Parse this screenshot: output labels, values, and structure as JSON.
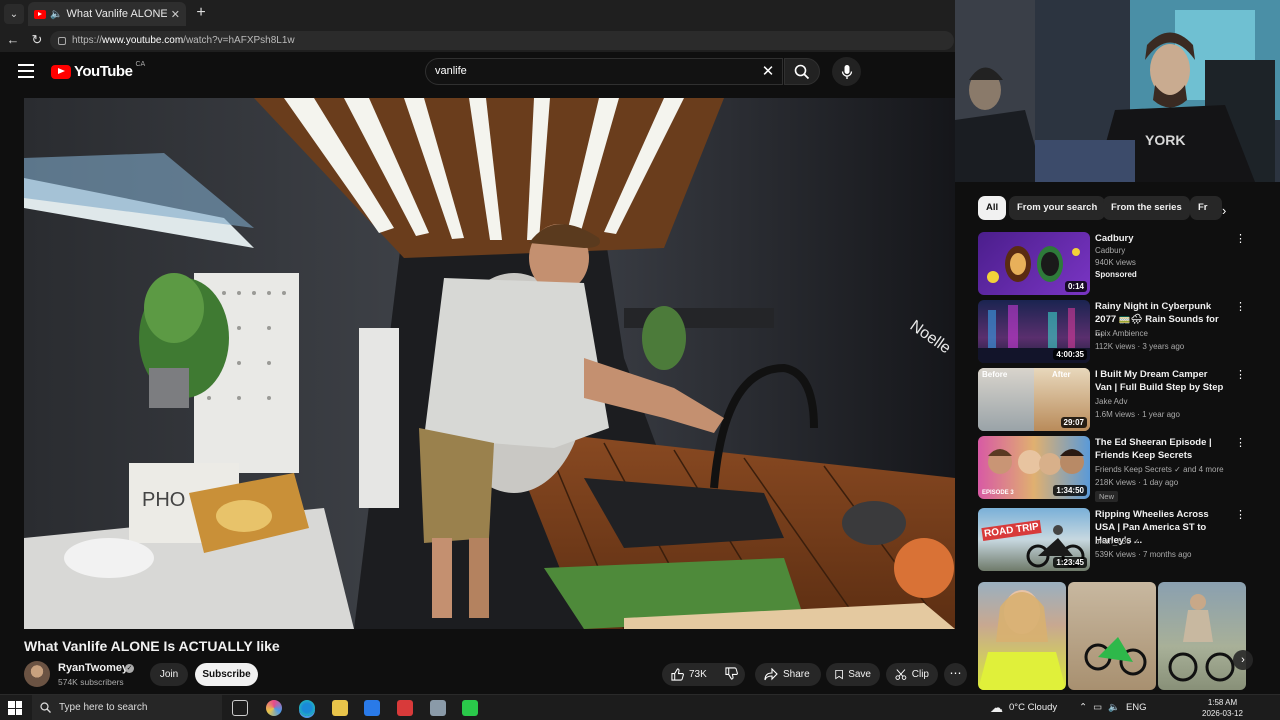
{
  "browser": {
    "tab_title": "What Vanlife ALONE Is ACTUALLY",
    "tab_close": "✕",
    "new_tab": "+",
    "url_prefix": "https://",
    "url_host": "www.youtube.com",
    "url_path": "/watch?v=hAFXPsh8L1w"
  },
  "header": {
    "logo_text": "YouTube",
    "country_code": "CA",
    "search_value": "vanlife"
  },
  "video": {
    "title": "What Vanlife ALONE Is ACTUALLY like",
    "channel_name": "RyanTwomey",
    "subscribers": "574K subscribers",
    "join_label": "Join",
    "subscribe_label": "Subscribe",
    "like_count": "73K",
    "share_label": "Share",
    "save_label": "Save",
    "clip_label": "Clip"
  },
  "chips": [
    "All",
    "From your search",
    "From the series",
    "Fr"
  ],
  "recommendations": [
    {
      "title": "Cadbury",
      "line1": "Cadbury",
      "line2": "940K views",
      "line3": "Sponsored",
      "duration": "0:14"
    },
    {
      "title": "Rainy Night in Cyberpunk 2077 🚃🌧 Rain Sounds for ...",
      "line1": "Epix Ambience",
      "line2": "112K views · 3 years ago",
      "duration": "4:00:35"
    },
    {
      "title": "I Built My Dream Camper Van | Full Build Step by Step",
      "line1": "Jake Adv",
      "line2": "1.6M views · 1 year ago",
      "duration": "29:07",
      "thumb_before": "Before",
      "thumb_after": "After"
    },
    {
      "title": "The Ed Sheeran Episode | Friends Keep Secrets",
      "line1": "Friends Keep Secrets",
      "line1_extra": "and 4 more",
      "line2": "218K views · 1 day ago",
      "badge": "New",
      "duration": "1:34:50",
      "thumb_tag": "EPISODE 3"
    },
    {
      "title": "Ripping Wheelies Across USA | Pan America ST to Harley's ...",
      "line1": "brian_636",
      "line2": "539K views · 7 months ago",
      "duration": "1:23:45",
      "thumb_tag": "ROAD TRIP"
    }
  ],
  "taskbar": {
    "search_placeholder": "Type here to search",
    "weather": "0°C  Cloudy",
    "language": "ENG",
    "time": "1:58 AM",
    "date": "2026-03-12"
  },
  "colors": {
    "background": "#0f0f0f",
    "brand_red": "#ff0000",
    "chip_active": "#f1f1f1",
    "pill_bg": "#272727"
  },
  "icons": [
    "tab-list-icon",
    "youtube-favicon",
    "speaker-icon",
    "close-icon",
    "back-icon",
    "reload-icon",
    "menu-icon",
    "search-icon",
    "mic-icon",
    "like-icon",
    "dislike-icon",
    "share-icon",
    "save-icon",
    "clip-icon",
    "more-icon",
    "verified-icon",
    "chevron-right-icon",
    "windows-start-icon"
  ]
}
